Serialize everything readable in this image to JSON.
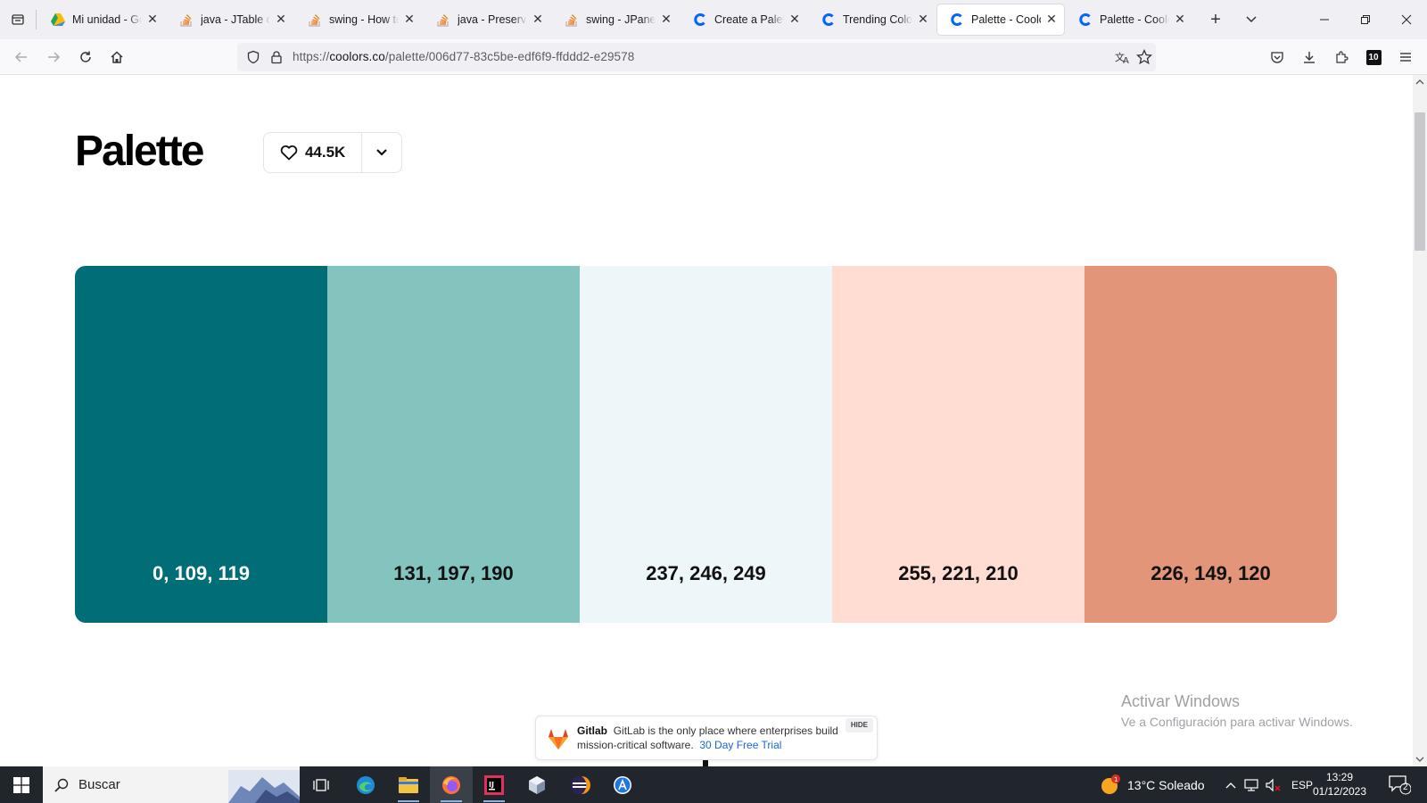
{
  "browser": {
    "tabs": [
      {
        "title": "Mi unidad - Goo",
        "icon": "google-drive-icon",
        "active": false
      },
      {
        "title": "java - JTable cha",
        "icon": "stackoverflow-icon",
        "active": false
      },
      {
        "title": "swing - How to",
        "icon": "stackoverflow-icon",
        "active": false
      },
      {
        "title": "java - Preserve b",
        "icon": "stackoverflow-icon",
        "active": false
      },
      {
        "title": "swing - JPanel P",
        "icon": "stackoverflow-icon",
        "active": false
      },
      {
        "title": "Create a Palette",
        "icon": "coolors-icon",
        "active": false
      },
      {
        "title": "Trending Color P",
        "icon": "coolors-icon",
        "active": false
      },
      {
        "title": "Palette - Coolors",
        "icon": "coolors-icon",
        "active": true
      },
      {
        "title": "Palette - Coolors",
        "icon": "coolors-icon",
        "active": false
      }
    ],
    "url_prefix": "https://",
    "url_host": "coolors.co",
    "url_path": "/palette/006d77-83c5be-edf6f9-ffddd2-e29578",
    "extension_badge": "10"
  },
  "page": {
    "title": "Palette",
    "likes": "44.5K",
    "swatches": [
      {
        "rgb": "0, 109, 119",
        "color": "#006d77",
        "text_color": "#ffffff"
      },
      {
        "rgb": "131, 197, 190",
        "color": "#83c5be",
        "text_color": "#111111"
      },
      {
        "rgb": "237, 246, 249",
        "color": "#edf6f9",
        "text_color": "#111111"
      },
      {
        "rgb": "255, 221, 210",
        "color": "#ffddd2",
        "text_color": "#111111"
      },
      {
        "rgb": "226, 149, 120",
        "color": "#e29578",
        "text_color": "#111111"
      }
    ],
    "ad": {
      "brand": "Gitlab",
      "text": "GitLab is the only place where enterprises build mission-critical software.",
      "cta": "30 Day Free Trial",
      "hide": "HIDE"
    },
    "watermark": {
      "line1": "Activar Windows",
      "line2": "Ve a Configuración para activar Windows."
    }
  },
  "taskbar": {
    "search_placeholder": "Buscar",
    "weather": "13°C  Soleado",
    "weather_badge": "1",
    "language": "ESP",
    "time": "13:29",
    "date": "01/12/2023",
    "notifications": "2"
  }
}
